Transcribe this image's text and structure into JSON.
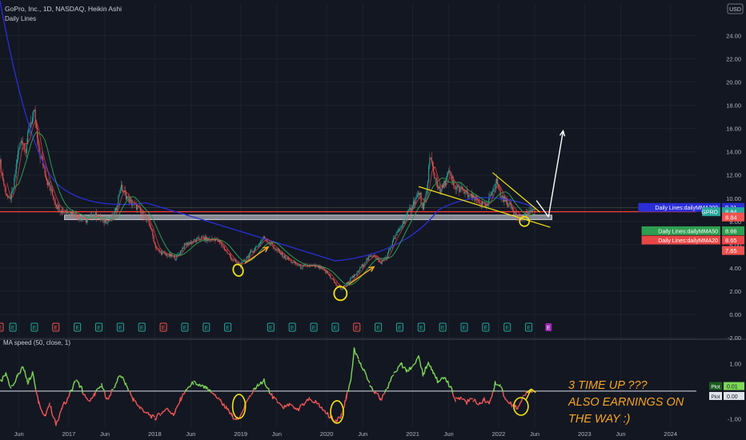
{
  "header": {
    "symbol_title": "GoPro, Inc., 1D, NASDAQ, Heikin Ashi",
    "indicator_label": "Daily Lines",
    "currency": "USD"
  },
  "oscillator": {
    "title": "MA speed (50, close, 1)"
  },
  "annotation": {
    "lines": [
      "3 TIME UP ???",
      "ALSO EARNINGS ON",
      "THE WAY :)"
    ]
  },
  "colors": {
    "background": "#131722",
    "candle_up": "#26a69a",
    "candle_down": "#ef5350",
    "ma200": "#2a2ed6",
    "ma50": "#2e9e50",
    "ma20": "#e84646",
    "support_line": "#ff3b3b",
    "drawing_yellow": "#f5e414",
    "drawing_orange": "#f5a623",
    "osc_up": "#7ed957",
    "osc_down": "#f25757",
    "earnings_up": "#26a69a",
    "earnings_down": "#ef5350",
    "earnings_next": "#9c27b0"
  },
  "chart_data": [
    {
      "type": "candlestick",
      "title": "GoPro, Inc., 1D, NASDAQ, Heikin Ashi",
      "ylim": [
        -2,
        25
      ],
      "y_ticks": [
        "24.00",
        "22.00",
        "20.00",
        "18.00",
        "16.00",
        "14.00",
        "12.00",
        "10.00",
        "8.00",
        "6.00",
        "4.00",
        "2.00",
        "0.00",
        "-2.00"
      ],
      "y_tick_values": [
        24,
        22,
        20,
        18,
        16,
        14,
        12,
        10,
        8,
        6,
        4,
        2,
        0,
        -2
      ],
      "x_ticks": [
        "Jun",
        "2017",
        "Jun",
        "2018",
        "Jun",
        "2019",
        "Jun",
        "2020",
        "Jun",
        "2021",
        "Jun",
        "2022",
        "Jun",
        "2023",
        "Jun",
        "2024"
      ],
      "x_tick_values": [
        2016.42,
        2017.0,
        2017.42,
        2018.0,
        2018.42,
        2019.0,
        2019.42,
        2020.0,
        2020.42,
        2021.0,
        2021.42,
        2022.0,
        2022.42,
        2023.0,
        2023.42,
        2024.0
      ],
      "xlim": [
        2016.2,
        2024.3
      ],
      "price_path": [
        [
          2016.2,
          13.0
        ],
        [
          2016.25,
          11.0
        ],
        [
          2016.3,
          9.8
        ],
        [
          2016.35,
          10.5
        ],
        [
          2016.4,
          13.5
        ],
        [
          2016.45,
          15.2
        ],
        [
          2016.5,
          14.2
        ],
        [
          2016.55,
          16.5
        ],
        [
          2016.6,
          17.2
        ],
        [
          2016.65,
          14.0
        ],
        [
          2016.7,
          13.0
        ],
        [
          2016.75,
          11.5
        ],
        [
          2016.8,
          10.5
        ],
        [
          2016.85,
          9.5
        ],
        [
          2016.9,
          9.0
        ],
        [
          2016.95,
          8.8
        ],
        [
          2017.0,
          8.9
        ],
        [
          2017.1,
          8.4
        ],
        [
          2017.2,
          8.1
        ],
        [
          2017.3,
          8.6
        ],
        [
          2017.4,
          8.0
        ],
        [
          2017.5,
          8.2
        ],
        [
          2017.55,
          9.0
        ],
        [
          2017.6,
          11.0
        ],
        [
          2017.65,
          10.4
        ],
        [
          2017.72,
          9.6
        ],
        [
          2017.8,
          9.2
        ],
        [
          2017.87,
          8.5
        ],
        [
          2017.95,
          7.6
        ],
        [
          2018.0,
          6.0
        ],
        [
          2018.05,
          5.4
        ],
        [
          2018.15,
          5.1
        ],
        [
          2018.25,
          4.9
        ],
        [
          2018.35,
          6.0
        ],
        [
          2018.45,
          6.3
        ],
        [
          2018.55,
          6.6
        ],
        [
          2018.62,
          6.4
        ],
        [
          2018.7,
          6.5
        ],
        [
          2018.78,
          6.0
        ],
        [
          2018.85,
          5.2
        ],
        [
          2018.92,
          4.6
        ],
        [
          2019.0,
          4.2
        ],
        [
          2019.08,
          5.0
        ],
        [
          2019.18,
          5.8
        ],
        [
          2019.27,
          6.6
        ],
        [
          2019.33,
          6.2
        ],
        [
          2019.42,
          5.5
        ],
        [
          2019.5,
          5.0
        ],
        [
          2019.6,
          4.5
        ],
        [
          2019.7,
          4.1
        ],
        [
          2019.8,
          4.2
        ],
        [
          2019.9,
          4.1
        ],
        [
          2020.0,
          3.6
        ],
        [
          2020.05,
          3.2
        ],
        [
          2020.1,
          2.6
        ],
        [
          2020.18,
          2.2
        ],
        [
          2020.25,
          2.8
        ],
        [
          2020.35,
          3.5
        ],
        [
          2020.45,
          4.6
        ],
        [
          2020.55,
          5.2
        ],
        [
          2020.62,
          4.4
        ],
        [
          2020.7,
          5.0
        ],
        [
          2020.78,
          6.5
        ],
        [
          2020.86,
          7.5
        ],
        [
          2020.93,
          8.5
        ],
        [
          2021.0,
          9.5
        ],
        [
          2021.08,
          10.5
        ],
        [
          2021.12,
          8.9
        ],
        [
          2021.16,
          10.5
        ],
        [
          2021.2,
          13.6
        ],
        [
          2021.25,
          12.0
        ],
        [
          2021.32,
          10.5
        ],
        [
          2021.38,
          11.5
        ],
        [
          2021.42,
          12.2
        ],
        [
          2021.48,
          11.0
        ],
        [
          2021.55,
          10.8
        ],
        [
          2021.62,
          10.4
        ],
        [
          2021.7,
          10.0
        ],
        [
          2021.78,
          9.7
        ],
        [
          2021.86,
          9.2
        ],
        [
          2021.93,
          10.8
        ],
        [
          2021.98,
          11.5
        ],
        [
          2022.02,
          10.2
        ],
        [
          2022.08,
          9.8
        ],
        [
          2022.15,
          9.2
        ],
        [
          2022.22,
          8.5
        ],
        [
          2022.28,
          8.2
        ],
        [
          2022.35,
          8.9
        ],
        [
          2022.42,
          8.84
        ]
      ],
      "series": [
        {
          "name": "Daily Lines:dailyMMA200",
          "last": 9.21
        },
        {
          "name": "Daily Lines:dailyMMA50",
          "last": 8.66
        },
        {
          "name": "Daily Lines:dailyMMA20",
          "last": 8.65
        },
        {
          "name": "GPRO",
          "last": 8.84
        }
      ],
      "price_labels": [
        {
          "name": "Daily Lines:dailyMMA200",
          "value": "9.21",
          "y": 9.21
        },
        {
          "name": "GPRO",
          "value": "8.84",
          "y": 8.84
        },
        {
          "name": "",
          "value": "8.84",
          "y": 8.38
        },
        {
          "name": "Daily Lines:dailyMMA50",
          "value": "8.66",
          "y": 7.2
        },
        {
          "name": "Daily Lines:dailyMMA20",
          "value": "8.65",
          "y": 6.4
        },
        {
          "name": "",
          "value": "7.65",
          "y": 5.5
        }
      ],
      "support_level": 8.84,
      "support_zone": [
        8.15,
        8.55
      ],
      "earnings_events_up": [
        2016.35,
        2016.6,
        2017.1,
        2017.35,
        2017.6,
        2017.85,
        2018.35,
        2018.6,
        2018.85,
        2019.35,
        2019.6,
        2019.85,
        2020.1,
        2020.6,
        2020.85,
        2021.1,
        2021.35,
        2021.6,
        2021.85,
        2022.1,
        2022.35
      ],
      "earnings_events_down": [
        2016.2,
        2016.85,
        2018.1,
        2020.35
      ],
      "earnings_event_next": 2022.58
    },
    {
      "type": "line",
      "title": "MA speed (50, close, 1)",
      "ylim": [
        -1.3,
        1.7
      ],
      "y_ticks": [
        "1.00",
        "-1.00"
      ],
      "y_tick_values": [
        1,
        -1
      ],
      "zero_line": 0,
      "series_path": [
        [
          2016.2,
          0.3
        ],
        [
          2016.27,
          0.6
        ],
        [
          2016.33,
          0.1
        ],
        [
          2016.4,
          0.5
        ],
        [
          2016.47,
          0.9
        ],
        [
          2016.52,
          0.3
        ],
        [
          2016.58,
          0.7
        ],
        [
          2016.65,
          -0.4
        ],
        [
          2016.72,
          -0.9
        ],
        [
          2016.78,
          -0.5
        ],
        [
          2016.85,
          -1.2
        ],
        [
          2016.92,
          -0.6
        ],
        [
          2017.0,
          -0.2
        ],
        [
          2017.08,
          0.4
        ],
        [
          2017.15,
          0.1
        ],
        [
          2017.22,
          -0.4
        ],
        [
          2017.3,
          -0.1
        ],
        [
          2017.38,
          0.2
        ],
        [
          2017.45,
          -0.3
        ],
        [
          2017.52,
          0.1
        ],
        [
          2017.6,
          0.6
        ],
        [
          2017.67,
          0.2
        ],
        [
          2017.75,
          -0.3
        ],
        [
          2017.83,
          -0.6
        ],
        [
          2017.92,
          -0.8
        ],
        [
          2018.0,
          -1.0
        ],
        [
          2018.07,
          -0.8
        ],
        [
          2018.15,
          -0.6
        ],
        [
          2018.22,
          -0.9
        ],
        [
          2018.3,
          -0.3
        ],
        [
          2018.38,
          0.1
        ],
        [
          2018.45,
          0.3
        ],
        [
          2018.52,
          0.2
        ],
        [
          2018.6,
          0.1
        ],
        [
          2018.68,
          -0.1
        ],
        [
          2018.75,
          -0.3
        ],
        [
          2018.83,
          -0.6
        ],
        [
          2018.9,
          -0.9
        ],
        [
          2018.97,
          -1.0
        ],
        [
          2019.05,
          -0.5
        ],
        [
          2019.12,
          -0.1
        ],
        [
          2019.2,
          0.2
        ],
        [
          2019.27,
          0.4
        ],
        [
          2019.35,
          -0.1
        ],
        [
          2019.42,
          -0.4
        ],
        [
          2019.5,
          -0.6
        ],
        [
          2019.57,
          -0.5
        ],
        [
          2019.65,
          -0.7
        ],
        [
          2019.72,
          -0.5
        ],
        [
          2019.8,
          -0.3
        ],
        [
          2019.87,
          -0.4
        ],
        [
          2019.93,
          -0.6
        ],
        [
          2020.0,
          -0.8
        ],
        [
          2020.07,
          -1.0
        ],
        [
          2020.12,
          -1.1
        ],
        [
          2020.18,
          -0.8
        ],
        [
          2020.23,
          -0.2
        ],
        [
          2020.28,
          0.4
        ],
        [
          2020.32,
          1.5
        ],
        [
          2020.37,
          1.1
        ],
        [
          2020.42,
          0.8
        ],
        [
          2020.5,
          0.3
        ],
        [
          2020.57,
          -0.1
        ],
        [
          2020.63,
          -0.3
        ],
        [
          2020.7,
          0.1
        ],
        [
          2020.78,
          0.6
        ],
        [
          2020.86,
          1.0
        ],
        [
          2020.93,
          0.7
        ],
        [
          2021.0,
          0.9
        ],
        [
          2021.07,
          1.2
        ],
        [
          2021.12,
          0.6
        ],
        [
          2021.18,
          1.0
        ],
        [
          2021.24,
          0.7
        ],
        [
          2021.3,
          0.3
        ],
        [
          2021.37,
          0.5
        ],
        [
          2021.43,
          0.2
        ],
        [
          2021.5,
          -0.3
        ],
        [
          2021.57,
          -0.2
        ],
        [
          2021.63,
          -0.4
        ],
        [
          2021.7,
          -0.3
        ],
        [
          2021.77,
          -0.5
        ],
        [
          2021.83,
          -0.3
        ],
        [
          2021.9,
          -0.4
        ],
        [
          2021.96,
          0.3
        ],
        [
          2022.02,
          0.2
        ],
        [
          2022.08,
          -0.3
        ],
        [
          2022.15,
          -0.5
        ],
        [
          2022.22,
          -0.6
        ],
        [
          2022.28,
          -0.2
        ],
        [
          2022.35,
          0.0
        ],
        [
          2022.42,
          0.01
        ]
      ],
      "price_labels": [
        {
          "name": "Plot",
          "value": "0.01",
          "y": 0.01
        },
        {
          "name": "Plot",
          "value": "0.00",
          "y": 0.0
        }
      ]
    }
  ]
}
